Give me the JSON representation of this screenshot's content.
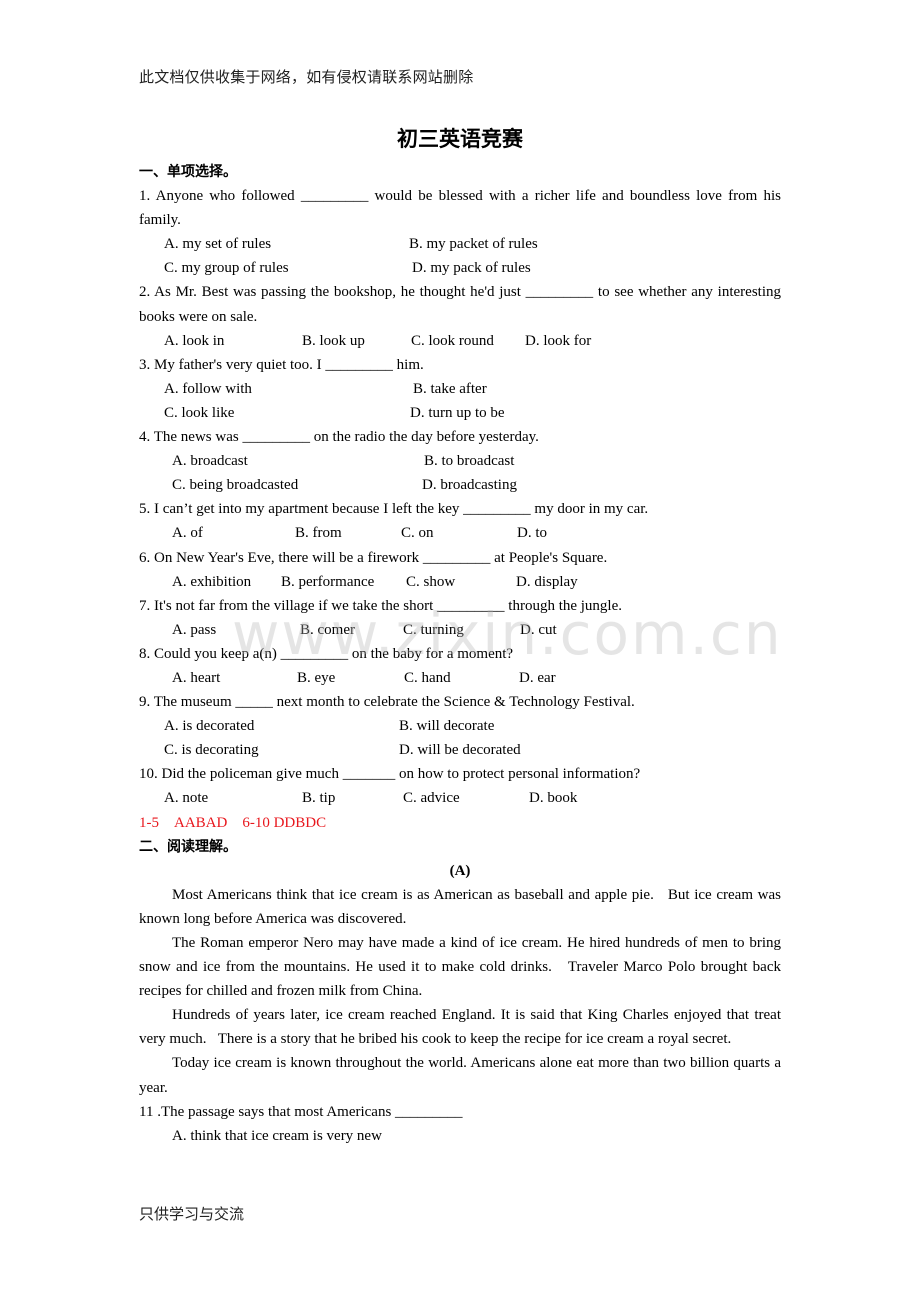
{
  "header_note": "此文档仅供收集于网络，如有侵权请联系网站删除",
  "title": "初三英语竞赛",
  "section1": {
    "heading": "一、单项选择。",
    "questions": [
      {
        "stem": "1. Anyone who followed _________ would be blessed with a richer life and boundless love from his family.",
        "options": [
          "A. my set of rules",
          "B. my packet of rules",
          "C. my group of rules",
          "D. my pack of rules"
        ]
      },
      {
        "stem": "2. As Mr. Best was passing the bookshop, he thought he'd just _________ to see whether any interesting books were on sale.",
        "options": [
          "A. look in",
          "B. look up",
          "C. look round",
          "D. look for"
        ]
      },
      {
        "stem": "3. My father's very quiet too. I _________ him.",
        "options": [
          "A. follow with",
          "B. take after",
          "C. look like",
          "D. turn up to be"
        ]
      },
      {
        "stem": "4. The news was _________ on the radio the day before yesterday.",
        "options": [
          "A. broadcast",
          "B. to broadcast",
          "C. being broadcasted",
          "D. broadcasting"
        ]
      },
      {
        "stem": "5. I can’t get into my apartment because I left the key _________ my door in my car.",
        "options": [
          "A. of",
          "B. from",
          "C. on",
          "D. to"
        ]
      },
      {
        "stem": "6. On New Year's Eve, there will be a firework _________ at People's Square.",
        "options": [
          "A. exhibition",
          "B. performance",
          "C. show",
          "D. display"
        ]
      },
      {
        "stem": "7. It's not far from the village if we take the short _________ through the jungle.",
        "options": [
          "A. pass",
          "B. comer",
          "C. turning",
          "D. cut"
        ]
      },
      {
        "stem": "8. Could you keep a(n) _________ on the baby for a moment?",
        "options": [
          "A. heart",
          "B. eye",
          "C. hand",
          "D. ear"
        ]
      },
      {
        "stem": "9. The museum _____ next month to celebrate the Science & Technology Festival.",
        "options": [
          "A. is decorated",
          "B. will decorate",
          "C. is decorating",
          "D. will be decorated"
        ]
      },
      {
        "stem": "10. Did the policeman give much _______ on how to protect personal information?",
        "options": [
          "A. note",
          "B. tip",
          "C. advice",
          "D. book"
        ]
      }
    ],
    "answer_key": "1-5    AABAD    6-10 DDBDC",
    "answer_color": "#e8171d"
  },
  "section2": {
    "heading": "二、阅读理解。",
    "passage_label": "(A)",
    "paragraphs": [
      "Most Americans think that ice cream is as American as baseball and apple pie.   But ice cream was known long before America was discovered.",
      "The Roman emperor Nero may have made a kind of ice cream. He hired hundreds of men to bring snow and ice from the mountains. He used it to make cold drinks.   Traveler Marco Polo brought back recipes for chilled and frozen milk from China.",
      "Hundreds of years later, ice cream reached England. It is said that King Charles enjoyed that treat very much.   There is a story that he bribed his cook to keep the recipe for ice cream a royal secret.",
      "Today ice cream is known throughout the world. Americans alone eat more than two billion quarts a year."
    ],
    "question11": {
      "stem": "11 .The passage says that most Americans _________",
      "option_a": "A. think that ice cream is very new"
    }
  },
  "footer_note": "只供学习与交流",
  "watermark": "www.zixin.com.cn"
}
